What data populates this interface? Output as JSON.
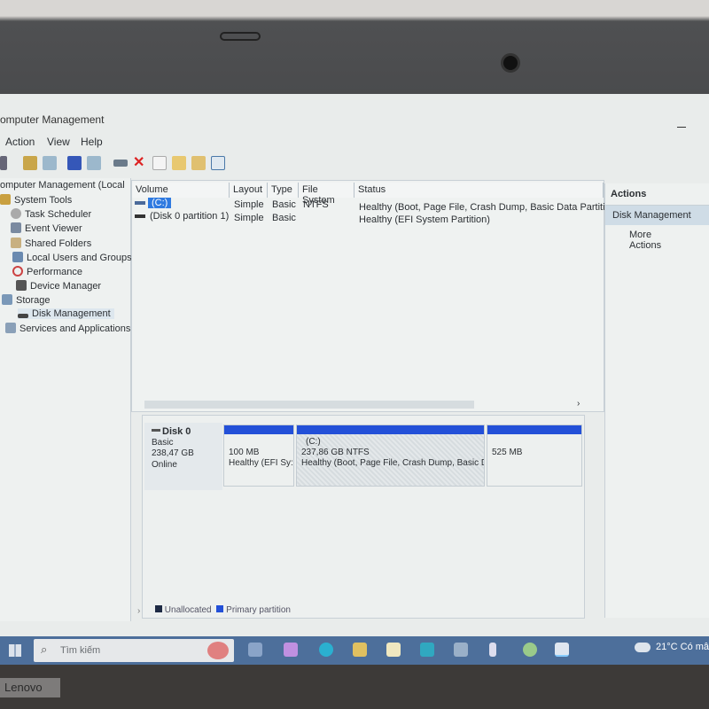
{
  "window": {
    "title": "omputer Management",
    "menu": [
      "Action",
      "View",
      "Help"
    ]
  },
  "toolbar": {
    "icons": [
      "forward-icon",
      "up-folder-icon",
      "show-hide-console-tree-icon",
      "help-icon",
      "show-hide-action-pane-icon",
      "connect-drive-icon",
      "delete-icon",
      "properties-icon",
      "export-icon",
      "search-folder-icon",
      "settings-icon"
    ]
  },
  "tree": {
    "root": "omputer Management (Local",
    "items": [
      {
        "label": "System Tools"
      },
      {
        "label": "Task Scheduler"
      },
      {
        "label": "Event Viewer"
      },
      {
        "label": "Shared Folders"
      },
      {
        "label": "Local Users and Groups"
      },
      {
        "label": "Performance"
      },
      {
        "label": "Device Manager"
      },
      {
        "label": "Storage"
      },
      {
        "label": "Disk Management"
      },
      {
        "label": "Services and Applications"
      }
    ]
  },
  "volumes": {
    "headers": [
      "Volume",
      "Layout",
      "Type",
      "File System",
      "Status"
    ],
    "rows": [
      {
        "volume": "(C:)",
        "layout": "Simple",
        "type": "Basic",
        "fs": "NTFS",
        "status": "Healthy (Boot, Page File, Crash Dump, Basic Data Partition)"
      },
      {
        "volume": "(Disk 0 partition 1)",
        "layout": "Simple",
        "type": "Basic",
        "fs": "",
        "status": "Healthy (EFI System Partition)"
      }
    ]
  },
  "disk": {
    "name": "Disk 0",
    "type": "Basic",
    "size": "238,47 GB",
    "state": "Online",
    "partitions": [
      {
        "label": "",
        "size": "100 MB",
        "status": "Healthy (EFI Sy:"
      },
      {
        "label": "(C:)",
        "size": "237,86 GB NTFS",
        "status": "Healthy (Boot, Page File, Crash Dump, Basic D"
      },
      {
        "label": "",
        "size": "525 MB",
        "status": ""
      }
    ]
  },
  "legend": {
    "unallocated": "Unallocated",
    "primary": "Primary partition",
    "colors": {
      "unallocated": "#1e2a44",
      "primary": "#2350d8"
    }
  },
  "actions": {
    "header": "Actions",
    "section": "Disk Management",
    "more": "More Actions"
  },
  "taskbar": {
    "search_placeholder": "Tìm kiếm",
    "weather": "21°C  Có mâ"
  },
  "brand": "Lenovo"
}
